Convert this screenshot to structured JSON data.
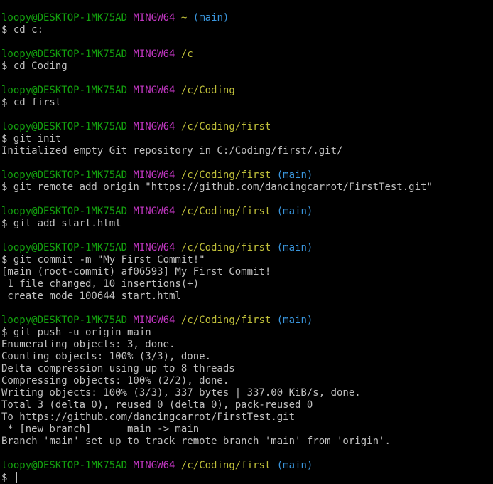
{
  "colors": {
    "background": "#000000",
    "text": "#c0c0c0",
    "user_host": "#13a10e",
    "msystem": "#c136c1",
    "path": "#c0c03a",
    "branch": "#3a96dd"
  },
  "prompt": {
    "user_host": "loopy@DESKTOP-1MK75AD",
    "msystem": "MINGW64"
  },
  "blocks": [
    {
      "path": "~",
      "branch": "(main)",
      "command": "$ cd c:",
      "output": []
    },
    {
      "path": "/c",
      "branch": "",
      "command": "$ cd Coding",
      "output": []
    },
    {
      "path": "/c/Coding",
      "branch": "",
      "command": "$ cd first",
      "output": []
    },
    {
      "path": "/c/Coding/first",
      "branch": "",
      "command": "$ git init",
      "output": [
        "Initialized empty Git repository in C:/Coding/first/.git/"
      ]
    },
    {
      "path": "/c/Coding/first",
      "branch": "(main)",
      "command": "$ git remote add origin \"https://github.com/dancingcarrot/FirstTest.git\"",
      "output": []
    },
    {
      "path": "/c/Coding/first",
      "branch": "(main)",
      "command": "$ git add start.html",
      "output": []
    },
    {
      "path": "/c/Coding/first",
      "branch": "(main)",
      "command": "$ git commit -m \"My First Commit!\"",
      "output": [
        "[main (root-commit) af06593] My First Commit!",
        " 1 file changed, 10 insertions(+)",
        " create mode 100644 start.html"
      ]
    },
    {
      "path": "/c/Coding/first",
      "branch": "(main)",
      "command": "$ git push -u origin main",
      "output": [
        "Enumerating objects: 3, done.",
        "Counting objects: 100% (3/3), done.",
        "Delta compression using up to 8 threads",
        "Compressing objects: 100% (2/2), done.",
        "Writing objects: 100% (3/3), 337 bytes | 337.00 KiB/s, done.",
        "Total 3 (delta 0), reused 0 (delta 0), pack-reused 0",
        "To https://github.com/dancingcarrot/FirstTest.git",
        " * [new branch]      main -> main",
        "Branch 'main' set up to track remote branch 'main' from 'origin'."
      ]
    },
    {
      "path": "/c/Coding/first",
      "branch": "(main)",
      "command": "$ ",
      "output": [],
      "active": true
    }
  ]
}
